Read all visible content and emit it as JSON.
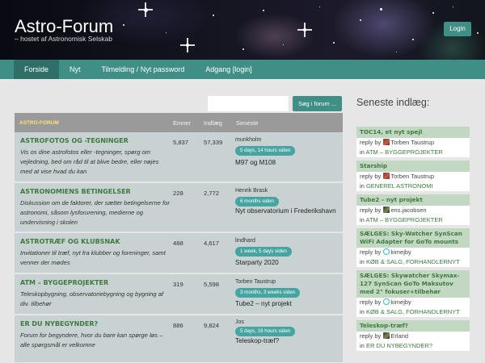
{
  "header": {
    "title": "Astro-Forum",
    "subtitle": "– hostet af Astronomisk Selskab",
    "login_label": "Login"
  },
  "nav": {
    "items": [
      {
        "label": "Forside"
      },
      {
        "label": "Nyt"
      },
      {
        "label": "Tilmelding / Nyt password"
      },
      {
        "label": "Adgang [login]"
      }
    ]
  },
  "search": {
    "placeholder": "",
    "button_label": "Søg i forum ..."
  },
  "table": {
    "headers": {
      "forum": "ASTRO-FORUM",
      "emner": "Emner",
      "indlaeg": "Indlæg",
      "seneste": "Seneste"
    },
    "rows": [
      {
        "title": "ASTROFOTOS OG -TEGNINGER",
        "description": "Vis os dine astrofotos eller -tegninger, spørg om vejledning, bed om råd til at blive bedre, eller nøjes med at vise hvad du kan",
        "emner": "5,837",
        "indlaeg": "57,339",
        "user": "munkholm",
        "time": "5 days, 14 hours siden",
        "latest": "M97 og M108"
      },
      {
        "title": "ASTRONOMIENS BETINGELSER",
        "description": "Diskussion om de faktorer, der sætter betingelserne for astronomi, såsom lysforurening, medierne og undervisning i skolen",
        "emner": "228",
        "indlaeg": "2,772",
        "user": "Henrik Brask",
        "time": "6 months siden",
        "latest": "Nyt observatorium i Frederikshavn"
      },
      {
        "title": "ASTROTRÆF OG KLUBSNAK",
        "description": "Invitationer til træf, nyt fra klubber og foreninger, samt venner der mødes",
        "emner": "488",
        "indlaeg": "4,617",
        "user": "lindhard",
        "time": "1 week, 5 days siden",
        "latest": "Starparty 2020"
      },
      {
        "title": "ATM – BYGGEPROJEKTER",
        "description": "Teleskopbygning, observatoriebygning og bygning af div. tilbehør",
        "emner": "319",
        "indlaeg": "5,598",
        "user": "Torben Taustrup",
        "time": "3 months, 3 weeks siden",
        "latest": "Tube2 – nyt projekt"
      },
      {
        "title": "ER DU NYBEGYNDER?",
        "description": "Forum for begyndere, hvor du bare kan spørge løs – alle spørgsmål er velkomne",
        "emner": "886",
        "indlaeg": "9,824",
        "user": "Jos",
        "time": "5 days, 16 hours siden",
        "latest": "Teleskop-træf?"
      }
    ]
  },
  "sidebar": {
    "title": "Seneste indlæg:",
    "items": [
      {
        "head": "TOC14, et nyt spejl",
        "reply": "reply by",
        "user": "Torben Taustrup",
        "avatar": "red",
        "in": "in",
        "category": "ATM – BYGGEPROJEKTER"
      },
      {
        "head": "Starship",
        "reply": "reply by",
        "user": "Torben Taustrup",
        "avatar": "red",
        "in": "in",
        "category": "GENEREL ASTRONOMI"
      },
      {
        "head": "Tube2 – nyt projekt",
        "reply": "reply by",
        "user": "ens.jacobsen",
        "avatar": "dark",
        "in": "in",
        "category": "ATM – BYGGEPROJEKTER"
      },
      {
        "head": "SÆLGES: Sky-Watcher SynScan WiFi Adapter for GoTo mounts",
        "reply": "reply by",
        "user": "kimejby",
        "avatar": "cyan",
        "in": "in",
        "category": "KØB & SALG, FORHANDLERNYT"
      },
      {
        "head": "SÆLGES: Skywatcher Skymax-127 SynScan GoTo Maksutov med 2\" fokuser+tilbehør",
        "reply": "reply by",
        "user": "kimejby",
        "avatar": "cyan",
        "in": "in",
        "category": "KØB & SALG, FORHANDLERNYT"
      },
      {
        "head": "Teleskop-træf?",
        "reply": "reply by",
        "user": "Erland",
        "avatar": "dark",
        "in": "in",
        "category": "ER DU NYBEGYNDER?"
      }
    ]
  },
  "colors": {
    "accent": "#3f8f86",
    "nav_active": "#2f6f68",
    "title_green": "#3d7b3d",
    "badge": "#46a5a0",
    "row_bg": "#c8d2d2",
    "header_gray": "#9a9a9a"
  }
}
